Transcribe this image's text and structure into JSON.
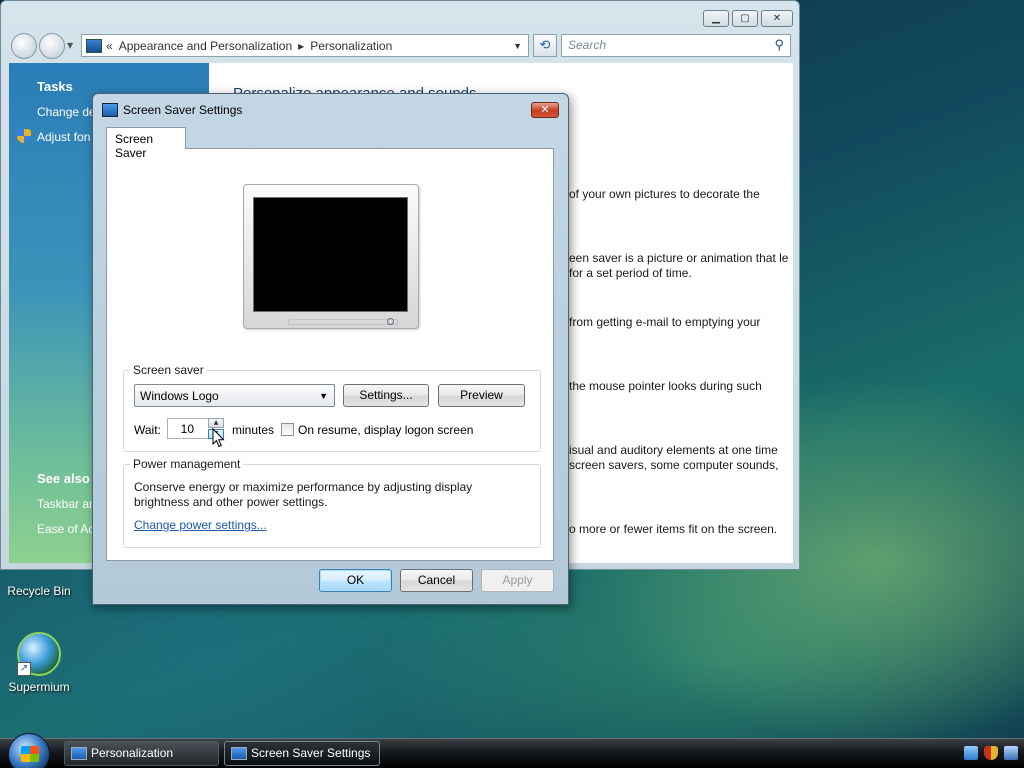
{
  "desktop": {
    "icons": [
      {
        "label": "Recycle Bin"
      },
      {
        "label": "Supermium"
      }
    ]
  },
  "personalization_window": {
    "breadcrumb_prefix": "«",
    "breadcrumb": [
      "Appearance and Personalization",
      "Personalization"
    ],
    "search_placeholder": "Search",
    "sidebar": {
      "tasks_heading": "Tasks",
      "tasks": [
        "Change de",
        "Adjust fon"
      ],
      "see_also_heading": "See also",
      "see_also": [
        "Taskbar an",
        "Ease of Ac"
      ]
    },
    "content": {
      "title": "Personalize appearance and sounds",
      "snippets": [
        "of your own pictures to decorate the",
        "een saver is a picture or animation that le for a set period of time.",
        "from getting e-mail to emptying your",
        "the mouse pointer looks during such",
        "isual and auditory elements at one time screen savers, some computer sounds,",
        "o more or fewer items fit on the screen."
      ]
    }
  },
  "dialog": {
    "title": "Screen Saver Settings",
    "tab": "Screen Saver",
    "screen_saver_group": "Screen saver",
    "selected_screensaver": "Windows Logo",
    "settings_button": "Settings...",
    "preview_button": "Preview",
    "wait_label": "Wait:",
    "wait_value": "10",
    "minutes_label": "minutes",
    "resume_label": "On resume, display logon screen",
    "resume_checked": false,
    "power_group": "Power management",
    "power_desc": "Conserve energy or maximize performance by adjusting display brightness and other power settings.",
    "power_link": "Change power settings...",
    "ok_button": "OK",
    "cancel_button": "Cancel",
    "apply_button": "Apply"
  },
  "taskbar": {
    "items": [
      {
        "label": "Personalization",
        "active": false
      },
      {
        "label": "Screen Saver Settings",
        "active": true
      }
    ]
  }
}
